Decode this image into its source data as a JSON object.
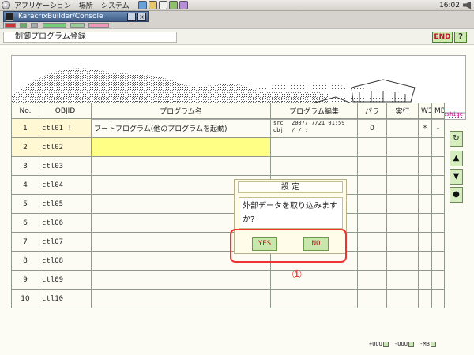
{
  "panel": {
    "menus": [
      "アプリケーション",
      "場所",
      "システム"
    ],
    "clock": "16:02"
  },
  "window": {
    "title": "KaracrixBuilder/Console",
    "minimize": "_",
    "close": "×"
  },
  "header": {
    "title": "制御プログラム登録",
    "end_label": "END",
    "help_label": "?"
  },
  "banner": {
    "caption": "KanbaraYorunoyuki(syohan)/Hiroshige"
  },
  "table": {
    "columns": [
      "No.",
      "OBJID",
      "プログラム名",
      "プログラム編集",
      "パラ",
      "実行",
      "W3",
      "MB"
    ],
    "rows": [
      {
        "no": "1",
        "objid": "ctl01 !",
        "name": "ブートプログラム(他のプログラムを起動)",
        "edit_src": "src",
        "edit_obj": "obj",
        "edit_ts": "2007/ 7/21 01:59",
        "edit_ts2": "/ /      :",
        "para": "0",
        "exec": "",
        "w3": "*",
        "mb": "-"
      },
      {
        "no": "2",
        "objid": "ctl02",
        "name": "",
        "edit_src": "",
        "edit_obj": "",
        "edit_ts": "",
        "edit_ts2": "",
        "para": "",
        "exec": "",
        "w3": "",
        "mb": ""
      },
      {
        "no": "3",
        "objid": "ctl03",
        "name": "",
        "edit_src": "",
        "edit_obj": "",
        "edit_ts": "",
        "edit_ts2": "",
        "para": "",
        "exec": "",
        "w3": "",
        "mb": ""
      },
      {
        "no": "4",
        "objid": "ctl04",
        "name": "",
        "edit_src": "",
        "edit_obj": "",
        "edit_ts": "",
        "edit_ts2": "",
        "para": "",
        "exec": "",
        "w3": "",
        "mb": ""
      },
      {
        "no": "5",
        "objid": "ctl05",
        "name": "",
        "edit_src": "",
        "edit_obj": "",
        "edit_ts": "",
        "edit_ts2": "",
        "para": "",
        "exec": "",
        "w3": "",
        "mb": ""
      },
      {
        "no": "6",
        "objid": "ctl06",
        "name": "",
        "edit_src": "",
        "edit_obj": "",
        "edit_ts": "",
        "edit_ts2": "",
        "para": "",
        "exec": "",
        "w3": "",
        "mb": ""
      },
      {
        "no": "7",
        "objid": "ctl07",
        "name": "",
        "edit_src": "",
        "edit_obj": "",
        "edit_ts": "",
        "edit_ts2": "",
        "para": "",
        "exec": "",
        "w3": "",
        "mb": ""
      },
      {
        "no": "8",
        "objid": "ctl08",
        "name": "",
        "edit_src": "",
        "edit_obj": "",
        "edit_ts": "",
        "edit_ts2": "",
        "para": "",
        "exec": "",
        "w3": "",
        "mb": ""
      },
      {
        "no": "9",
        "objid": "ctl09",
        "name": "",
        "edit_src": "",
        "edit_obj": "",
        "edit_ts": "",
        "edit_ts2": "",
        "para": "",
        "exec": "",
        "w3": "",
        "mb": ""
      },
      {
        "no": "10",
        "objid": "ctl10",
        "name": "",
        "edit_src": "",
        "edit_obj": "",
        "edit_ts": "",
        "edit_ts2": "",
        "para": "",
        "exec": "",
        "w3": "",
        "mb": ""
      }
    ]
  },
  "sidenav": {
    "refresh": "↻",
    "up": "▲",
    "down": "▼",
    "dot": "●"
  },
  "dialog": {
    "title": "設 定",
    "message": "外部データを取り込みますか?",
    "yes": "YES",
    "no": "NO"
  },
  "annotation": {
    "callout": "①"
  },
  "footer": {
    "plus": "+UUU",
    "minus": "-UUU",
    "mb": "-MB"
  },
  "colors": {
    "accent_green": "#cdeab0",
    "highlight_yellow": "#ffff86",
    "annotation_red": "#e33333"
  }
}
